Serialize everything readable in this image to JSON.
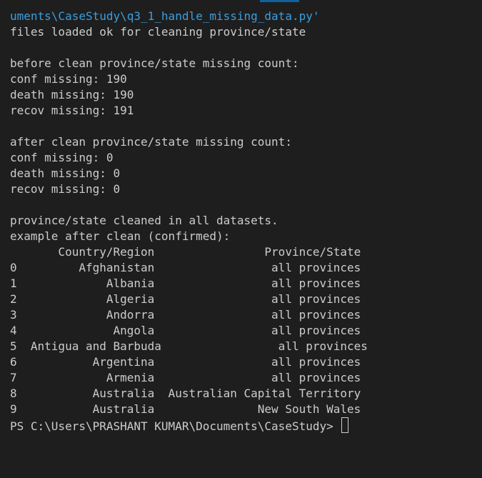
{
  "header": {
    "command_tail": "uments\\CaseStudy\\q3_1_handle_missing_data.py'"
  },
  "output": {
    "loaded": "files loaded ok for cleaning province/state",
    "before_title": "before clean province/state missing count:",
    "before_conf": "conf missing: 190",
    "before_death": "death missing: 190",
    "before_recov": "recov missing: 191",
    "after_title": "after clean province/state missing count:",
    "after_conf": "conf missing: 0",
    "after_death": "death missing: 0",
    "after_recov": "recov missing: 0",
    "cleaned": "province/state cleaned in all datasets.",
    "example_title": "example after clean (confirmed):"
  },
  "table": {
    "header": "       Country/Region                Province/State",
    "rows": [
      "0         Afghanistan                 all provinces",
      "1             Albania                 all provinces",
      "2             Algeria                 all provinces",
      "3             Andorra                 all provinces",
      "4              Angola                 all provinces",
      "5  Antigua and Barbuda                 all provinces",
      "6           Argentina                 all provinces",
      "7             Armenia                 all provinces",
      "8           Australia  Australian Capital Territory",
      "9           Australia               New South Wales"
    ]
  },
  "prompt": {
    "text": "PS C:\\Users\\PRASHANT KUMAR\\Documents\\CaseStudy> "
  },
  "colors": {
    "background": "#1e1e1e",
    "text": "#cccccc",
    "path": "#3b9ee0",
    "accent": "#0e639c"
  }
}
